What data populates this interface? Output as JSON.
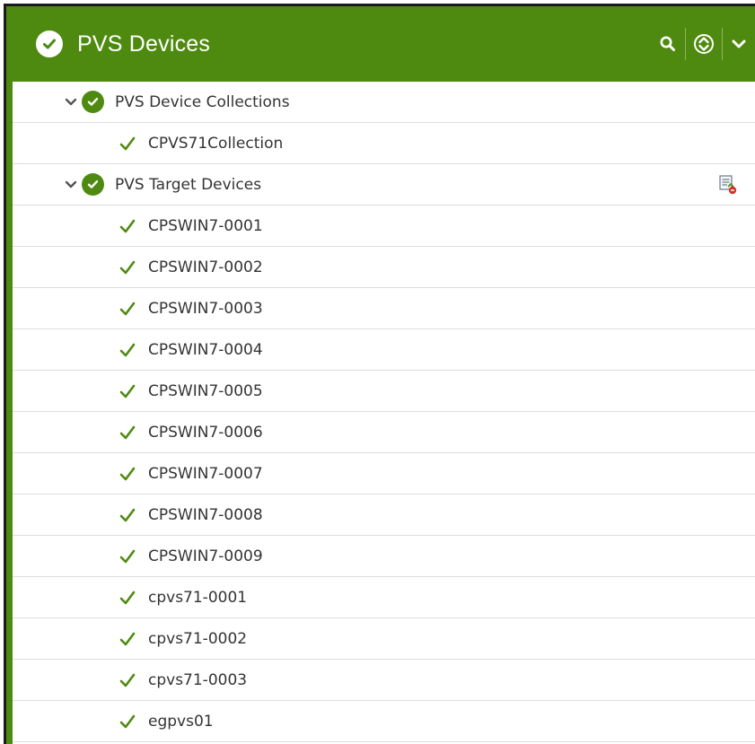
{
  "panel": {
    "title": "PVS Devices",
    "accent_color": "#4f8a10",
    "tools": {
      "search_icon": "search-icon",
      "sort_icon": "sort-updown-icon",
      "collapse_icon": "chevron-down-icon"
    }
  },
  "tree": {
    "collections": {
      "label": "PVS Device Collections",
      "status": "ok",
      "expanded": true,
      "items": [
        {
          "label": "CPVS71Collection",
          "status": "ok"
        }
      ]
    },
    "targets": {
      "label": "PVS Target Devices",
      "status": "ok",
      "expanded": true,
      "action_icon": "report-error-icon",
      "items": [
        {
          "label": "CPSWIN7-0001",
          "status": "ok"
        },
        {
          "label": "CPSWIN7-0002",
          "status": "ok"
        },
        {
          "label": "CPSWIN7-0003",
          "status": "ok"
        },
        {
          "label": "CPSWIN7-0004",
          "status": "ok"
        },
        {
          "label": "CPSWIN7-0005",
          "status": "ok"
        },
        {
          "label": "CPSWIN7-0006",
          "status": "ok"
        },
        {
          "label": "CPSWIN7-0007",
          "status": "ok"
        },
        {
          "label": "CPSWIN7-0008",
          "status": "ok"
        },
        {
          "label": "CPSWIN7-0009",
          "status": "ok"
        },
        {
          "label": "cpvs71-0001",
          "status": "ok"
        },
        {
          "label": "cpvs71-0002",
          "status": "ok"
        },
        {
          "label": "cpvs71-0003",
          "status": "ok"
        },
        {
          "label": "egpvs01",
          "status": "ok"
        }
      ]
    }
  }
}
